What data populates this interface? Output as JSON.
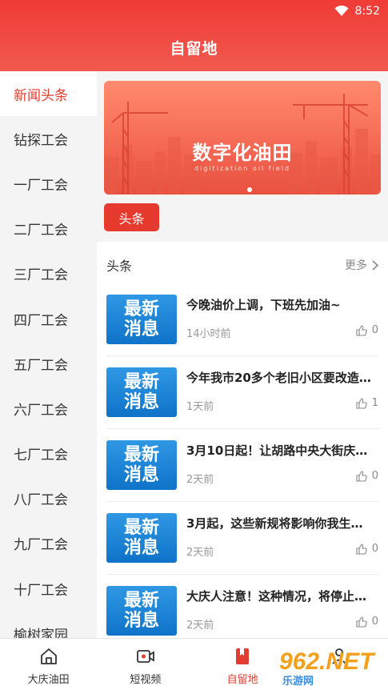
{
  "status": {
    "time": "8:52"
  },
  "header": {
    "title": "自留地"
  },
  "sidebar": {
    "items": [
      {
        "label": "新闻头条",
        "active": true
      },
      {
        "label": "钻探工会"
      },
      {
        "label": "一厂工会"
      },
      {
        "label": "二厂工会"
      },
      {
        "label": "三厂工会"
      },
      {
        "label": "四厂工会"
      },
      {
        "label": "五厂工会"
      },
      {
        "label": "六厂工会"
      },
      {
        "label": "七厂工会"
      },
      {
        "label": "八厂工会"
      },
      {
        "label": "九厂工会"
      },
      {
        "label": "十厂工会"
      },
      {
        "label": "榆树家园"
      }
    ]
  },
  "banner": {
    "title": "数字化油田",
    "subtitle": "digitization oil field"
  },
  "tab_chip": {
    "label": "头条"
  },
  "news": {
    "section_title": "头条",
    "more_label": "更多",
    "thumb_text": [
      "最新",
      "消息"
    ],
    "items": [
      {
        "title": "今晚油价上调，下班先加油~",
        "time": "14小时前",
        "likes": "0"
      },
      {
        "title": "今年我市20多个老旧小区要改造…",
        "time": "1天前",
        "likes": "1"
      },
      {
        "title": "3月10日起！让胡路中央大街庆…",
        "time": "2天前",
        "likes": "0"
      },
      {
        "title": "3月起，这些新规将影响你我生…",
        "time": "2天前",
        "likes": "0"
      },
      {
        "title": "大庆人注意！这种情况，将停止…",
        "time": "2天前",
        "likes": "0"
      }
    ]
  },
  "bottom_nav": {
    "items": [
      {
        "label": "大庆油田",
        "icon": "home-icon"
      },
      {
        "label": "短视频",
        "icon": "video-icon"
      },
      {
        "label": "自留地",
        "icon": "bookmark-icon",
        "active": true
      },
      {
        "label": "",
        "icon": "profile-icon"
      }
    ]
  },
  "watermark": {
    "big": "962.NET",
    "small": "乐游网"
  },
  "colors": {
    "accent": "#e33b2f",
    "thumb_blue": "#1a7fd4"
  }
}
